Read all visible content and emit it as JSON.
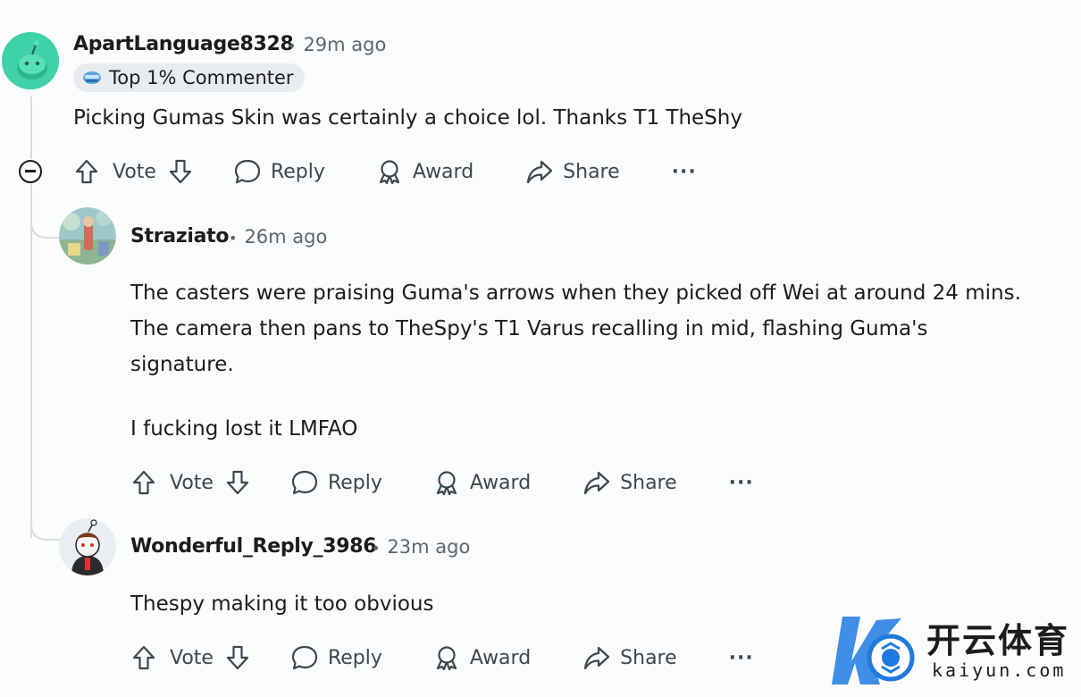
{
  "comments": [
    {
      "username": "ApartLanguage8328",
      "time": "29m ago",
      "flair": "Top 1% Commenter",
      "body": [
        "Picking Gumas Skin was certainly a choice lol. Thanks T1 TheShy"
      ],
      "actions": {
        "vote": "Vote",
        "reply": "Reply",
        "award": "Award",
        "share": "Share",
        "more": "···"
      }
    },
    {
      "username": "Straziato",
      "time": "26m ago",
      "body": [
        "The casters were praising Guma's arrows when they picked off Wei at around 24 mins. The camera then pans to TheSpy's T1 Varus recalling in mid, flashing Guma's signature.",
        "I fucking lost it LMFAO"
      ],
      "actions": {
        "vote": "Vote",
        "reply": "Reply",
        "award": "Award",
        "share": "Share",
        "more": "···"
      }
    },
    {
      "username": "Wonderful_Reply_3986",
      "time": "23m ago",
      "body": [
        "Thespy making it too obvious"
      ],
      "actions": {
        "vote": "Vote",
        "reply": "Reply",
        "award": "Award",
        "share": "Share",
        "more": "···"
      }
    }
  ],
  "watermark": {
    "cn": "开云体育",
    "en": "kaiyun.com"
  },
  "colors": {
    "accent_teal": "#3fd2a8",
    "watermark_blue": "#1f7ae0"
  }
}
